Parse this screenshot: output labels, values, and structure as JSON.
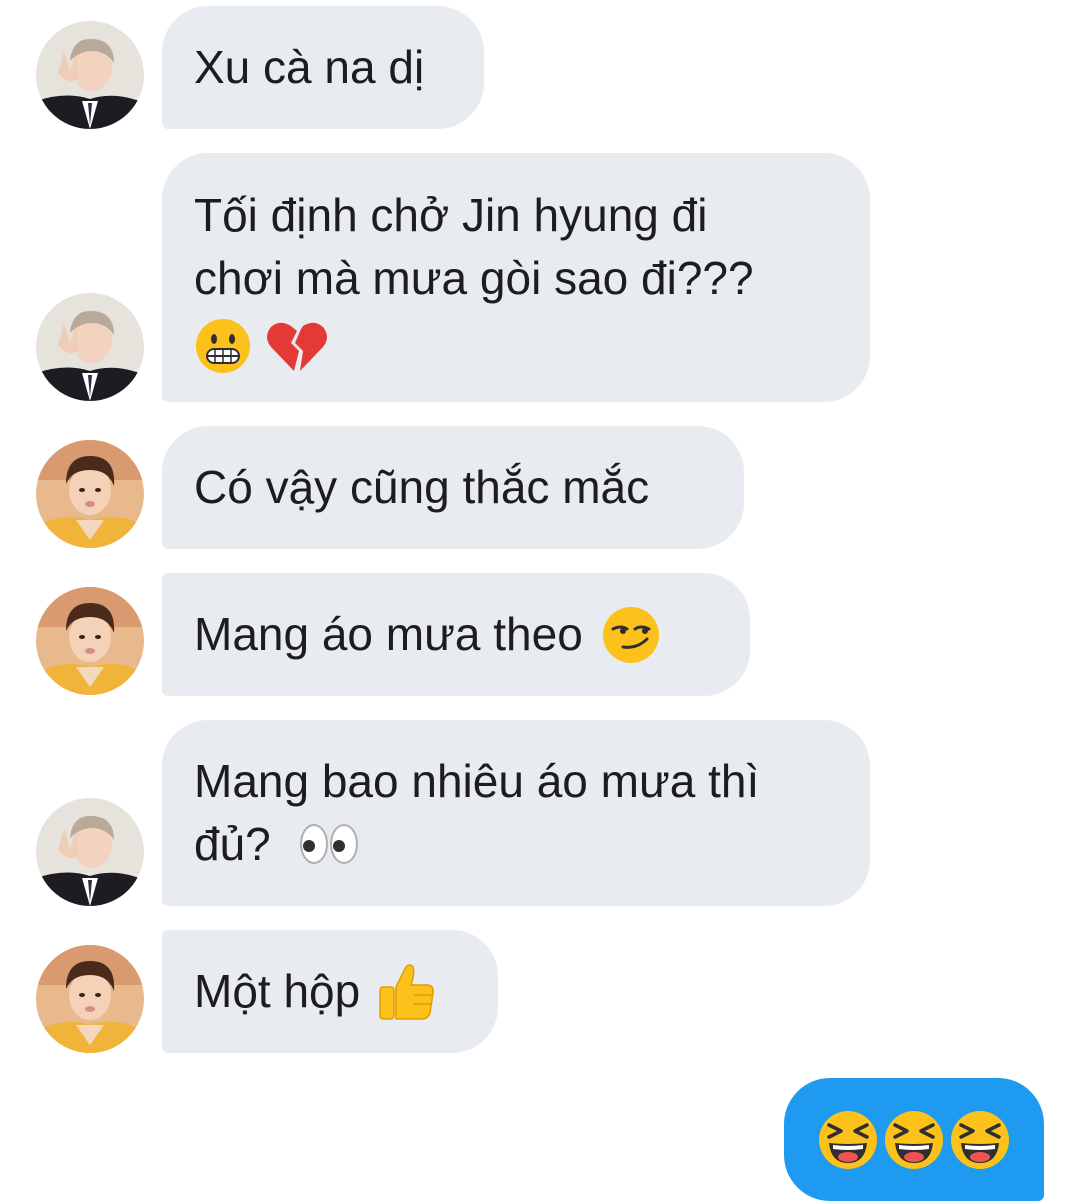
{
  "messages": [
    {
      "sender": "rm",
      "text": "Xu cà na dị",
      "emoji": []
    },
    {
      "sender": "rm",
      "text": "Tối định chở Jin hyung đi\nchơi mà mưa gòi sao đi???",
      "emoji": [
        "grimacing-face",
        "broken-heart"
      ]
    },
    {
      "sender": "v",
      "text": "Có vậy cũng thắc mắc",
      "emoji": []
    },
    {
      "sender": "v",
      "text": "Mang áo mưa theo",
      "emoji": [
        "smirking-face"
      ]
    },
    {
      "sender": "rm",
      "text": "Mang bao nhiêu áo mưa thì\nđủ?",
      "emoji": [
        "eyes"
      ]
    },
    {
      "sender": "v",
      "text": "Một hộp",
      "emoji": [
        "thumbs-up"
      ]
    }
  ],
  "sent_message": {
    "emoji": [
      "laughing-face",
      "laughing-face",
      "laughing-face"
    ]
  },
  "colors": {
    "incoming_bubble": "#e8ebef",
    "outgoing_bubble": "#1e9bf0",
    "text": "#1d1d1f",
    "background": "#ffffff"
  }
}
